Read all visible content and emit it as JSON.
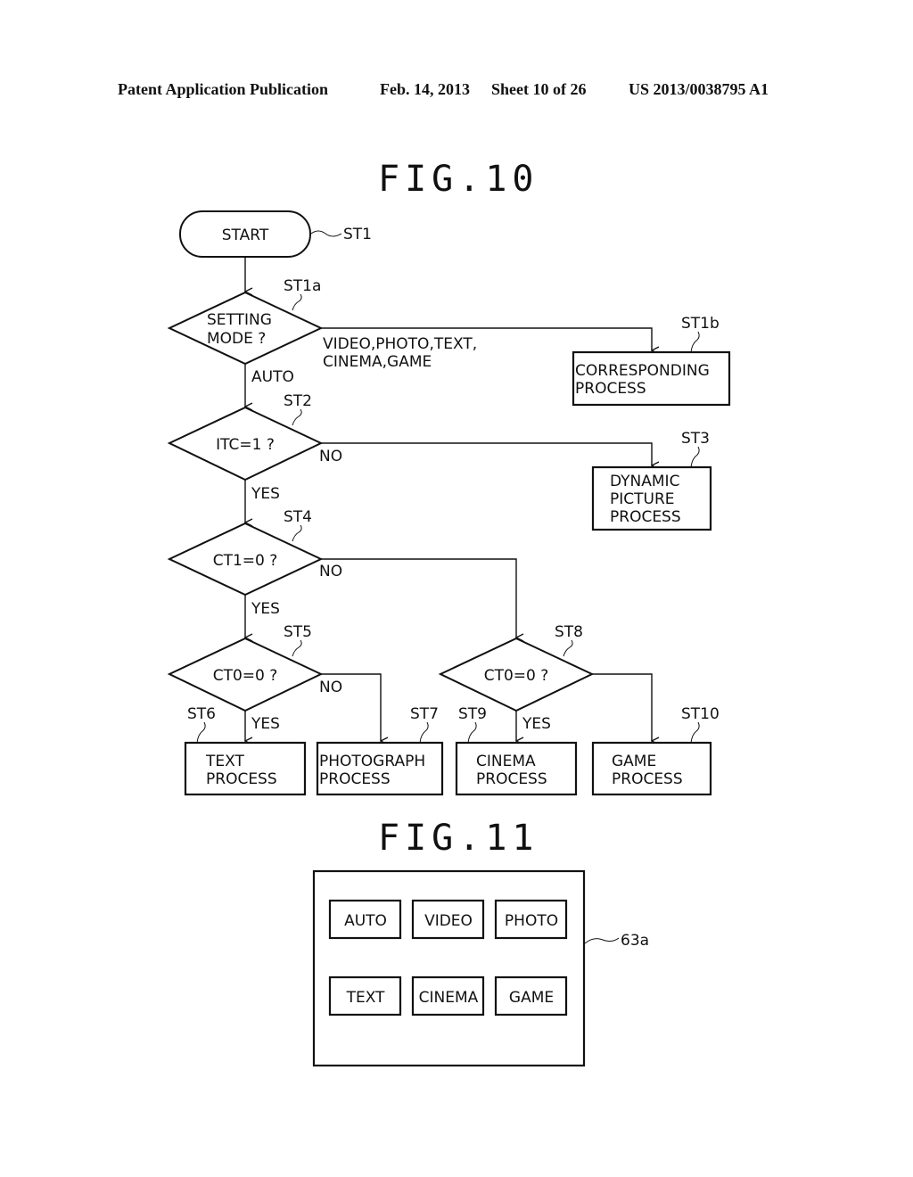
{
  "header": {
    "left": "Patent Application Publication",
    "date": "Feb. 14, 2013",
    "sheet": "Sheet 10 of 26",
    "number": "US 2013/0038795 A1"
  },
  "fig10": {
    "title": "FIG.10",
    "start": {
      "label": "START",
      "ref": "ST1"
    },
    "st1a": {
      "line1": "SETTING",
      "line2": "MODE ?",
      "ref": "ST1a",
      "branch_other_1": "VIDEO,PHOTO,TEXT,",
      "branch_other_2": "CINEMA,GAME",
      "branch_auto": "AUTO"
    },
    "st1b": {
      "line1": "CORRESPONDING",
      "line2": "PROCESS",
      "ref": "ST1b"
    },
    "st2": {
      "label": "ITC=1 ?",
      "ref": "ST2",
      "no": "NO",
      "yes": "YES"
    },
    "st3": {
      "line1": "DYNAMIC",
      "line2": "PICTURE",
      "line3": "PROCESS",
      "ref": "ST3"
    },
    "st4": {
      "label": "CT1=0 ?",
      "ref": "ST4",
      "no": "NO",
      "yes": "YES"
    },
    "st5": {
      "label": "CT0=0 ?",
      "ref": "ST5",
      "no": "NO",
      "yes": "YES"
    },
    "st6": {
      "line1": "TEXT",
      "line2": "PROCESS",
      "ref": "ST6"
    },
    "st7": {
      "line1": "PHOTOGRAPH",
      "line2": "PROCESS",
      "ref": "ST7"
    },
    "st8": {
      "label": "CT0=0 ?",
      "ref": "ST8",
      "yes": "YES"
    },
    "st9": {
      "line1": "CINEMA",
      "line2": "PROCESS",
      "ref": "ST9"
    },
    "st10": {
      "line1": "GAME",
      "line2": "PROCESS",
      "ref": "ST10"
    }
  },
  "fig11": {
    "title": "FIG.11",
    "ref": "63a",
    "buttons": [
      "AUTO",
      "VIDEO",
      "PHOTO",
      "TEXT",
      "CINEMA",
      "GAME"
    ]
  }
}
